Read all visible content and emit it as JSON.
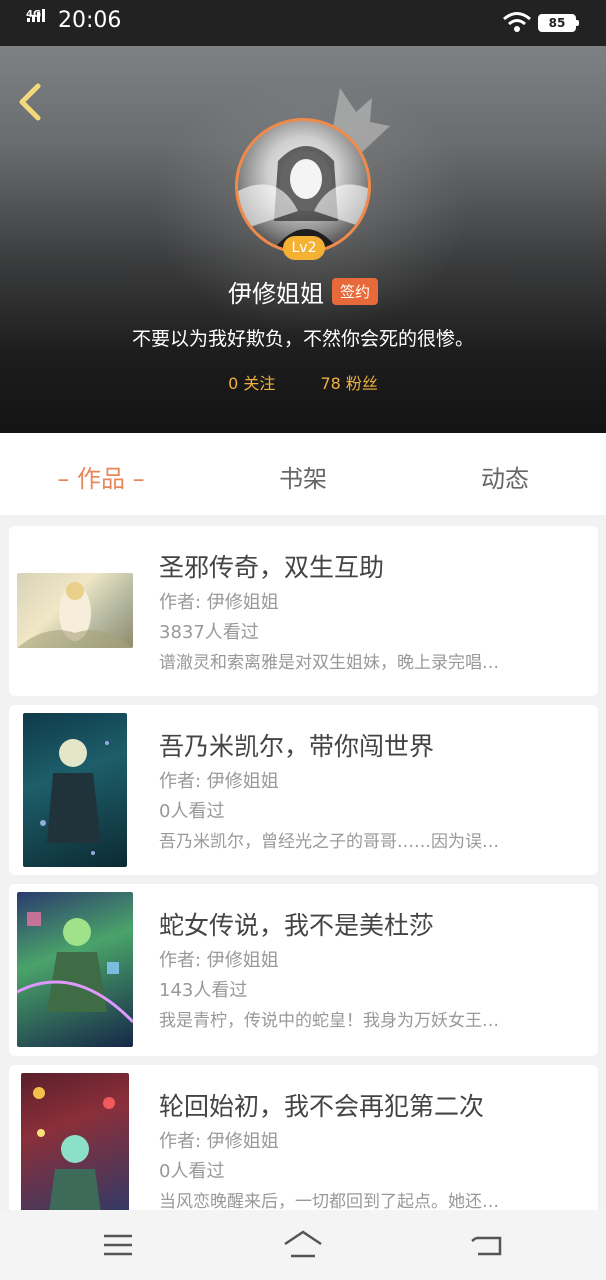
{
  "status_bar": {
    "network": "4G",
    "time": "20:06",
    "battery": "85"
  },
  "profile": {
    "level": "Lv2",
    "nickname": "伊修姐姐",
    "sign_tag": "签约",
    "bio": "不要以为我好欺负，不然你会死的很惨。",
    "following": "0 关注",
    "followers": "78 粉丝"
  },
  "tabs": [
    {
      "label": "– 作品 –"
    },
    {
      "label": "书架"
    },
    {
      "label": "动态"
    }
  ],
  "books": [
    {
      "title": "圣邪传奇，双生互助",
      "author": "作者: 伊修姐姐",
      "views": "3837人看过",
      "desc": "谱澈灵和索离雅是对双生姐妹，晚上录完唱…"
    },
    {
      "title": "吾乃米凯尔，带你闯世界",
      "author": "作者: 伊修姐姐",
      "views": "0人看过",
      "desc": "吾乃米凯尔，曾经光之子的哥哥……因为误…"
    },
    {
      "title": "蛇女传说，我不是美杜莎",
      "author": "作者: 伊修姐姐",
      "views": "143人看过",
      "desc": "我是青柠，传说中的蛇皇！我身为万妖女王…"
    },
    {
      "title": "轮回始初，我不会再犯第二次",
      "author": "作者: 伊修姐姐",
      "views": "0人看过",
      "desc": "当风恋晚醒来后，一切都回到了起点。她还…"
    }
  ],
  "colors": {
    "accent": "#e9875a",
    "badge": "#f5b133",
    "sign_tag": "#e86a3a",
    "stat_text": "#f0b040"
  }
}
